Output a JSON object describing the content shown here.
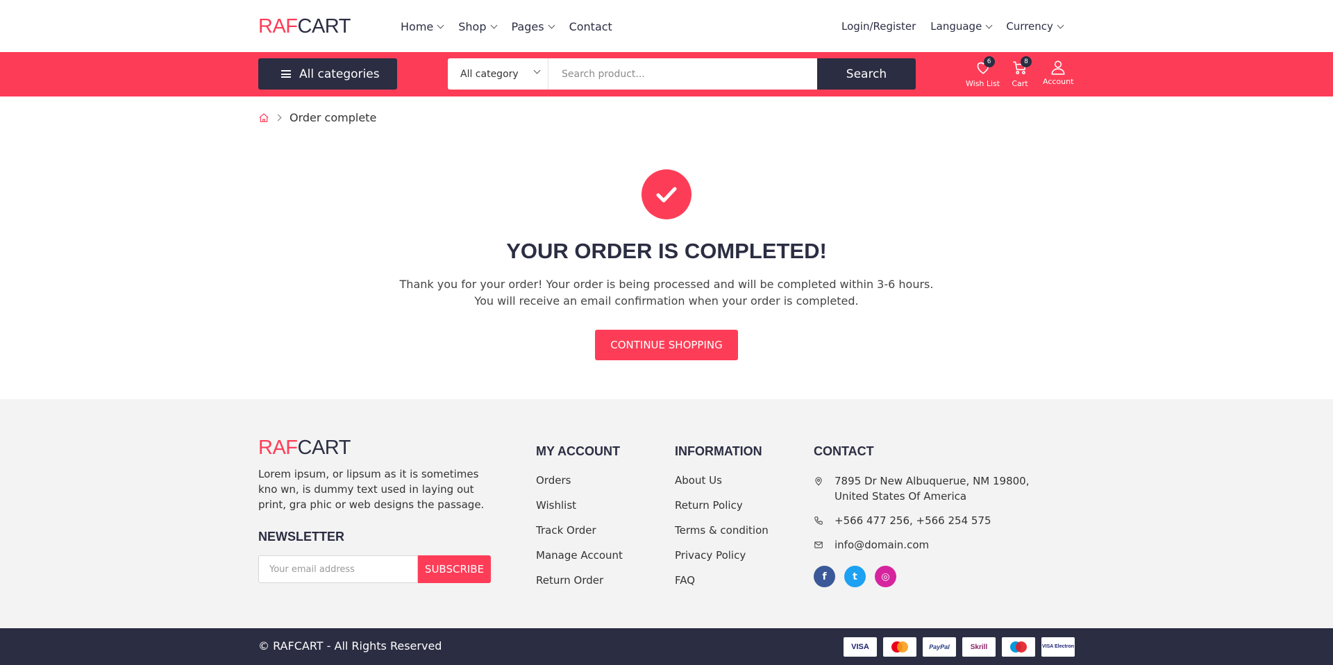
{
  "brand": {
    "part1": "RAF",
    "part2": "CART"
  },
  "nav": {
    "items": [
      "Home",
      "Shop",
      "Pages",
      "Contact"
    ],
    "login": "Login/Register",
    "language": "Language",
    "currency": "Currency"
  },
  "search": {
    "categories_label": "All categories",
    "category_select": "All category",
    "placeholder": "Search product...",
    "button": "Search"
  },
  "header_icons": {
    "wishlist": {
      "label": "Wish List",
      "count": "6"
    },
    "cart": {
      "label": "Cart",
      "count": "8"
    },
    "account": {
      "label": "Account"
    }
  },
  "breadcrumb": {
    "current": "Order complete"
  },
  "order": {
    "title": "YOUR ORDER IS COMPLETED!",
    "line1": "Thank you for your order! Your order is being processed and will be completed within 3-6 hours.",
    "line2": "You will receive an email confirmation when your order is completed.",
    "button": "CONTINUE SHOPPING"
  },
  "footer": {
    "about": "Lorem ipsum, or lipsum as it is sometimes kno wn, is dummy text used in laying out print, gra phic or web designs the passage.",
    "newsletter_title": "NEWSLETTER",
    "newsletter_placeholder": "Your email address",
    "subscribe": "SUBSCRIBE",
    "my_account": {
      "title": "MY ACCOUNT",
      "items": [
        "Orders",
        "Wishlist",
        "Track Order",
        "Manage Account",
        "Return Order"
      ]
    },
    "information": {
      "title": "INFORMATION",
      "items": [
        "About Us",
        "Return Policy",
        "Terms & condition",
        "Privacy Policy",
        "FAQ"
      ]
    },
    "contact": {
      "title": "CONTACT",
      "address1": "7895 Dr New Albuquerue, NM 19800,",
      "address2": "United States Of America",
      "phone": "+566 477 256, +566 254 575",
      "email": "info@domain.com"
    },
    "social": [
      {
        "icon": "facebook-icon",
        "color": "#3b5998",
        "glyph": "f"
      },
      {
        "icon": "twitter-icon",
        "color": "#1da1f2",
        "glyph": "t"
      },
      {
        "icon": "instagram-icon",
        "color": "#d6249f",
        "glyph": "◎"
      }
    ]
  },
  "bottom": {
    "copyright": "© RAFCART - All Rights Reserved",
    "payments": [
      {
        "name": "VISA",
        "color": "#1a1f71"
      },
      {
        "name": "mastercard",
        "color": "#eb001b"
      },
      {
        "name": "PayPal",
        "color": "#253b80"
      },
      {
        "name": "Skrill",
        "color": "#862165"
      },
      {
        "name": "Maestro",
        "color": "#0099df"
      },
      {
        "name": "VISA Electron",
        "color": "#1a1f71"
      }
    ]
  },
  "colors": {
    "accent": "#fd3d57",
    "dark": "#2b2d42",
    "footer_bg": "#f3f3f3"
  }
}
